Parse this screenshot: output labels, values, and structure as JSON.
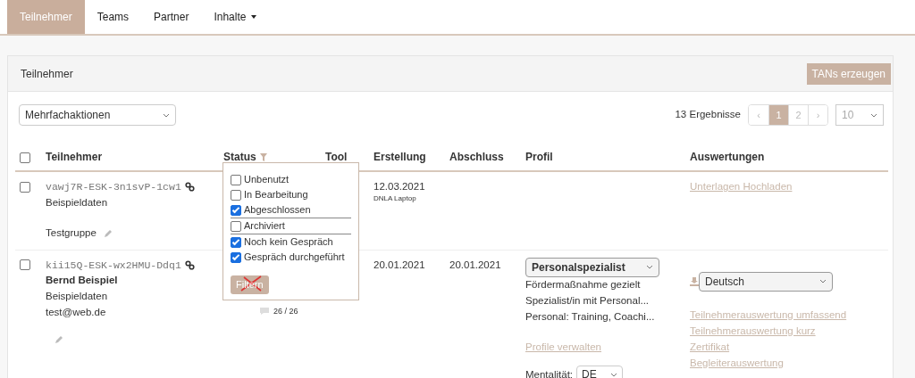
{
  "nav": {
    "tabs": [
      {
        "label": "Teilnehmer",
        "selected": true,
        "has_menu": false
      },
      {
        "label": "Teams",
        "selected": false,
        "has_menu": false
      },
      {
        "label": "Partner",
        "selected": false,
        "has_menu": false
      },
      {
        "label": "Inhalte",
        "selected": false,
        "has_menu": true
      }
    ]
  },
  "panel": {
    "title": "Teilnehmer",
    "action_button": "TANs erzeugen"
  },
  "toolbar": {
    "bulk_actions": "Mehrfachaktionen",
    "results": "13 Ergebnisse",
    "pagination": [
      {
        "label": "‹",
        "selected": false
      },
      {
        "label": "1",
        "selected": true
      },
      {
        "label": "2",
        "selected": false
      },
      {
        "label": "›",
        "selected": false
      }
    ],
    "page_size": "10"
  },
  "table": {
    "select_all_checked": false,
    "columns": [
      {
        "label": "Teilnehmer"
      },
      {
        "label": "Status",
        "has_filter": true
      },
      {
        "label": "Tool"
      },
      {
        "label": "Erstellung"
      },
      {
        "label": "Abschluss"
      },
      {
        "label": "Profil"
      },
      {
        "label": "Auswertungen"
      }
    ],
    "rows": [
      {
        "checked": false,
        "code": "vawj7R-ESK-3n1svP-1cw1",
        "details": [
          "Beispieldaten"
        ],
        "group": "Testgruppe",
        "created": "12.03.2021",
        "created_note": "DNLA Laptop",
        "evaluation_links": [
          "Unterlagen Hochladen"
        ]
      },
      {
        "checked": false,
        "code": "kii15Q-ESK-wx2HMU-Ddq1",
        "name": "Bernd Beispiel",
        "details": [
          "Beispieldaten",
          "test@web.de"
        ],
        "created": "20.01.2021",
        "closed": "20.01.2021",
        "comments": "26 / 26",
        "profile": {
          "select": "Personalspezialist",
          "lines": [
            "Fördermaßnahme gezielt",
            "Spezialist/in mit Personal...",
            "Personal: Training, Coachi..."
          ],
          "manage_link": "Profile verwalten",
          "mentality_label": "Mentalität:",
          "mentality_value": "DE"
        },
        "download": true,
        "language": "Deutsch",
        "evaluation_links": [
          "Teilnehmerauswertung umfassend",
          "Teilnehmerauswertung kurz",
          "Zertifikat",
          "Begleiterauswertung"
        ]
      }
    ]
  },
  "status_filter": {
    "groups": [
      [
        {
          "label": "Unbenutzt",
          "checked": false
        },
        {
          "label": "In Bearbeitung",
          "checked": false
        },
        {
          "label": "Abgeschlossen",
          "checked": true
        }
      ],
      [
        {
          "label": "Archiviert",
          "checked": false
        }
      ],
      [
        {
          "label": "Noch kein Gespräch",
          "checked": true
        },
        {
          "label": "Gespräch durchgeführt",
          "checked": true
        }
      ]
    ],
    "button": "Filtern",
    "crossed_out": true
  }
}
